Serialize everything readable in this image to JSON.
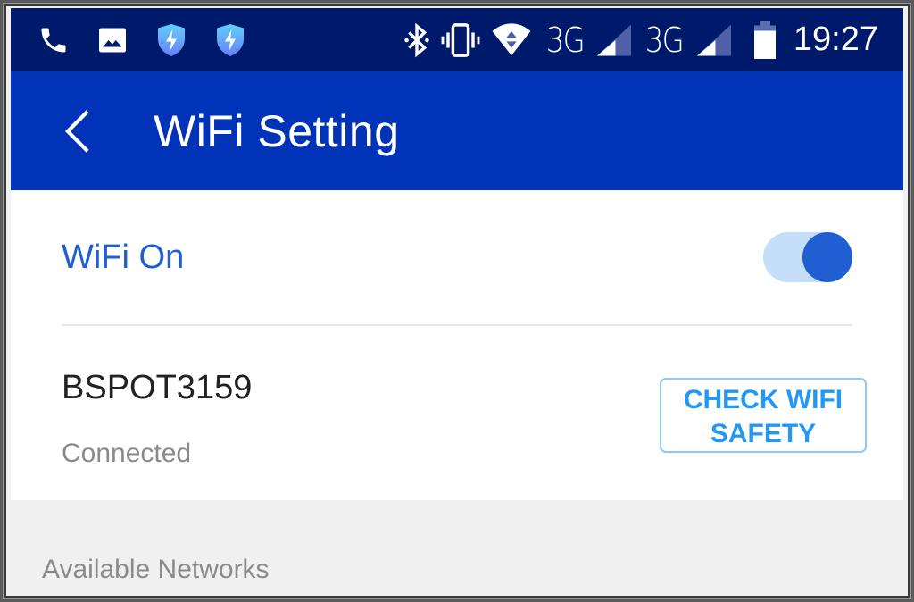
{
  "status_bar": {
    "left_icons": [
      "phone-icon",
      "image-icon",
      "shield-bolt-icon",
      "shield-bolt-icon"
    ],
    "right_icons": [
      "bluetooth-icon",
      "vibrate-icon",
      "wifi-data-icon",
      "signal-icon",
      "signal-icon",
      "battery-icon"
    ],
    "network_1": "3G",
    "network_2": "3G",
    "time": "19:27"
  },
  "app_bar": {
    "back_icon": "chevron-left-icon",
    "title": "WiFi Setting"
  },
  "wifi_toggle": {
    "label": "WiFi On",
    "state": "on"
  },
  "current_network": {
    "ssid": "BSPOT3159",
    "status": "Connected",
    "button_line1": "CHECK WIFI",
    "button_line2": "SAFETY"
  },
  "available_networks": {
    "label": "Available Networks"
  },
  "colors": {
    "status_bar": "#001a6b",
    "app_bar": "#0033b8",
    "accent": "#1f5fd3",
    "button_text": "#2298f5",
    "toggle_track": "#c5dffb"
  }
}
